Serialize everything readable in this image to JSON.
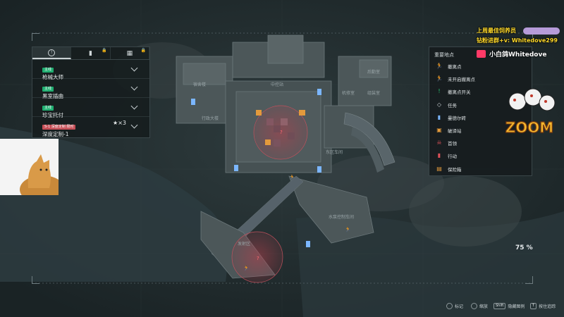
{
  "missions": {
    "tabs": [
      {
        "icon": "mission-alert-icon",
        "locked": false
      },
      {
        "icon": "flag-icon",
        "locked": true
      },
      {
        "icon": "calendar-icon",
        "locked": true
      }
    ],
    "items": [
      {
        "tag": "主线",
        "title": "枪械大师",
        "tag_color": "#1fae70",
        "extra": ""
      },
      {
        "tag": "主线",
        "title": "黑室插曲",
        "tag_color": "#1fae70",
        "extra": ""
      },
      {
        "tag": "主线",
        "title": "珍宝托付",
        "tag_color": "#1fae70",
        "extra": ""
      },
      {
        "tag": "S-1 深度定制 限时",
        "title": "深度定制-1",
        "tag_color": "#c64f57",
        "extra": "★×3"
      }
    ]
  },
  "legend": {
    "title": "重要地点",
    "items": [
      {
        "label": "撤离点",
        "icon": "running-exit-icon",
        "color": "#28c777"
      },
      {
        "label": "未开启撤离点",
        "icon": "running-exit-closed-icon",
        "color": "#9aa6aa"
      },
      {
        "label": "撤离点开关",
        "icon": "exit-switch-icon",
        "color": "#28c777"
      },
      {
        "label": "任务",
        "icon": "mission-icon",
        "color": "#cfd6d8"
      },
      {
        "label": "曼德尔砖",
        "icon": "mandel-brick-icon",
        "color": "#7bb6ff"
      },
      {
        "label": "破译站",
        "icon": "decrypt-station-icon",
        "color": "#e39a3c"
      },
      {
        "label": "首领",
        "icon": "boss-icon",
        "color": "#e05259"
      },
      {
        "label": "行动",
        "icon": "action-icon",
        "color": "#e05259"
      },
      {
        "label": "保险箱",
        "icon": "safe-icon",
        "color": "#e39a3c"
      }
    ]
  },
  "map": {
    "zoom": "75 %",
    "labels": [
      "宿舍楼",
      "行政大楼",
      "中控站",
      "东区车间",
      "水泵控制车间",
      "发射区",
      "机修室",
      "组装室",
      "后勤室"
    ]
  },
  "stream": {
    "promo_line1": "上周最佳饲养员",
    "promo_line2": "钻粉进群+v: Whitedove299",
    "streamer_name": "小白鸽Whitedove",
    "logo_text": "ZOOM"
  },
  "bottom_hints": [
    {
      "key": "",
      "label": "标记",
      "icon": "mouse-icon"
    },
    {
      "key": "",
      "label": "缩放",
      "icon": "scroll-icon"
    },
    {
      "key": "Shift",
      "label": "隐藏图例",
      "icon": ""
    },
    {
      "key": "T",
      "label": "按住追踪",
      "icon": ""
    }
  ],
  "colors": {
    "accent_green": "#1fae70",
    "danger_red": "#c64f57",
    "legend_bg": "#161c1e"
  }
}
